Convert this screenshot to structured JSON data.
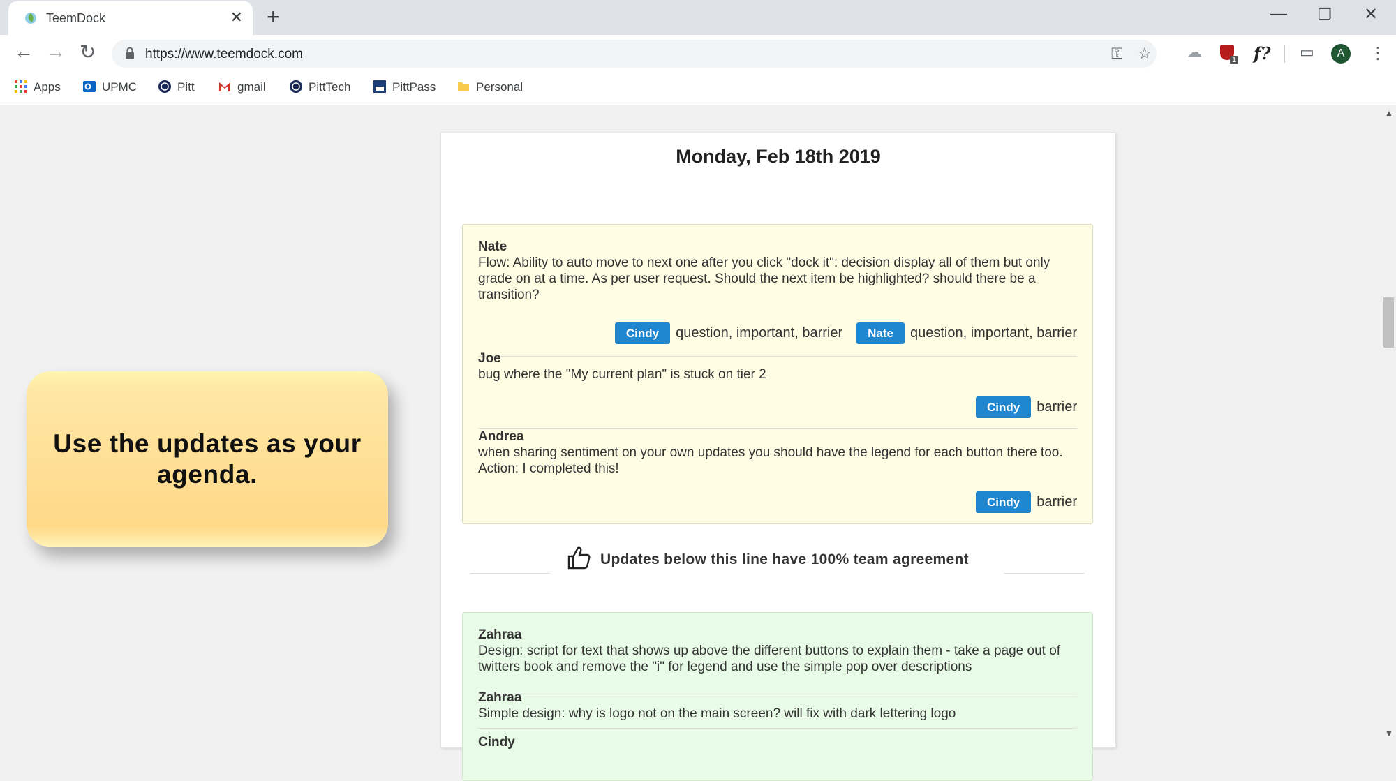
{
  "browser": {
    "tab_title": "TeemDock",
    "url": "https://www.teemdock.com",
    "profile_initial": "A",
    "extension_badge": "1",
    "extension_label": "f?",
    "bookmarks": [
      {
        "label": "Apps",
        "icon": "apps-grid-icon"
      },
      {
        "label": "UPMC",
        "icon": "outlook-icon"
      },
      {
        "label": "Pitt",
        "icon": "pitt-seal-icon"
      },
      {
        "label": "gmail",
        "icon": "gmail-icon"
      },
      {
        "label": "PittTech",
        "icon": "pitt-seal-icon"
      },
      {
        "label": "PittPass",
        "icon": "pittpass-icon"
      },
      {
        "label": "Personal",
        "icon": "folder-icon"
      }
    ]
  },
  "page": {
    "date_heading": "Monday, Feb 18th 2019",
    "pending_updates": [
      {
        "author": "Nate",
        "text": "Flow: Ability to auto move to next one after you click \"dock it\": decision display all of them but only grade on at a time. As per user request. Should the next item be highlighted? should there be a transition?",
        "tags": [
          {
            "person": "Cindy",
            "labels": "question, important, barrier"
          },
          {
            "person": "Nate",
            "labels": "question, important, barrier"
          }
        ]
      },
      {
        "author": "Joe",
        "text": "bug where the \"My current plan\" is stuck on tier 2",
        "tags": [
          {
            "person": "Cindy",
            "labels": "barrier"
          }
        ]
      },
      {
        "author": "Andrea",
        "text": "when sharing sentiment on your own updates you should have the legend for each button there too. Action: I completed this!",
        "tags": [
          {
            "person": "Cindy",
            "labels": "barrier"
          }
        ]
      }
    ],
    "agreement_text": "Updates below this line have 100% team agreement",
    "agreed_updates": [
      {
        "author": "Zahraa",
        "text": "Design: script for text that shows up above the different buttons to explain them - take a page out of twitters book and remove the \"i\" for legend and use the simple pop over descriptions"
      },
      {
        "author": "Zahraa",
        "text": "Simple design: why is logo not on the main screen? will fix with dark lettering logo"
      },
      {
        "author": "Cindy",
        "text": ""
      }
    ]
  },
  "callout": {
    "text": "Use the updates as your agenda."
  },
  "colors": {
    "tag_blue": "#1f86d0",
    "pending_bg": "#fffde4",
    "agreed_bg": "#e8fbe6",
    "callout": "#ffd888"
  }
}
